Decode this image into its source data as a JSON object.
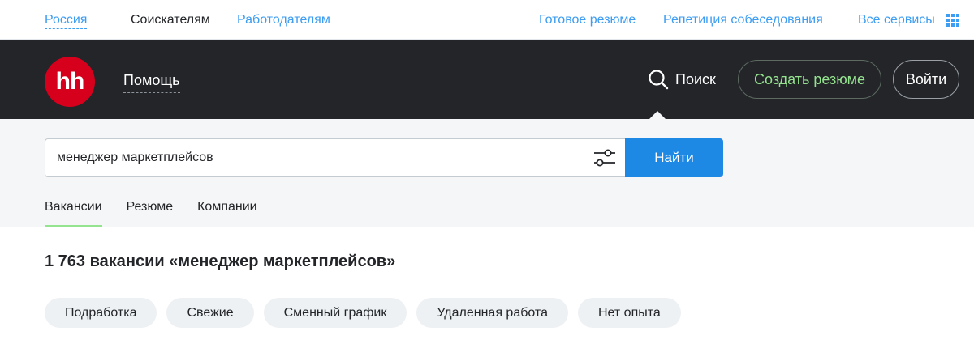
{
  "topbar": {
    "region": "Россия",
    "seekers": "Соискателям",
    "employers": "Работодателям",
    "ready_resume": "Готовое резюме",
    "interview_rehearsal": "Репетиция собеседования",
    "all_services": "Все сервисы"
  },
  "header": {
    "logo_text": "hh",
    "help": "Помощь",
    "search": "Поиск",
    "create_resume": "Создать резюме",
    "login": "Войти"
  },
  "search": {
    "query": "менеджер маркетплейсов",
    "find_button": "Найти"
  },
  "tabs": [
    {
      "label": "Вакансии",
      "active": true
    },
    {
      "label": "Резюме",
      "active": false
    },
    {
      "label": "Компании",
      "active": false
    }
  ],
  "results": {
    "title": "1 763 вакансии «менеджер маркетплейсов»"
  },
  "chips": [
    {
      "label": "Подработка"
    },
    {
      "label": "Свежие"
    },
    {
      "label": "Сменный график"
    },
    {
      "label": "Удаленная работа"
    },
    {
      "label": "Нет опыта"
    }
  ],
  "colors": {
    "header_bg": "#232529",
    "link_blue": "#3c9df2",
    "brand_red": "#d6001c",
    "accent_green": "#94e38e",
    "button_blue": "#1e88e5"
  }
}
